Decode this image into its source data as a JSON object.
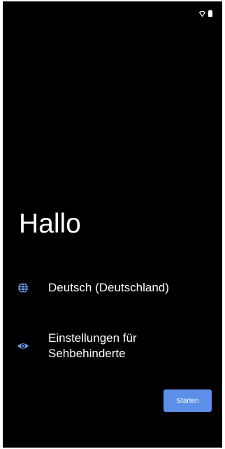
{
  "status_bar": {
    "icons": [
      "wifi-icon",
      "battery-icon"
    ]
  },
  "welcome": {
    "greeting": "Hallo"
  },
  "options": [
    {
      "icon": "globe-icon",
      "label": "Deutsch (Deutschland)"
    },
    {
      "icon": "eye-icon",
      "label": "Einstellungen für Sehbehinderte"
    }
  ],
  "actions": {
    "start_label": "Starten"
  },
  "colors": {
    "background": "#000000",
    "text": "#ffffff",
    "accent": "#5c8fe8",
    "icon": "#6e9cf0"
  }
}
